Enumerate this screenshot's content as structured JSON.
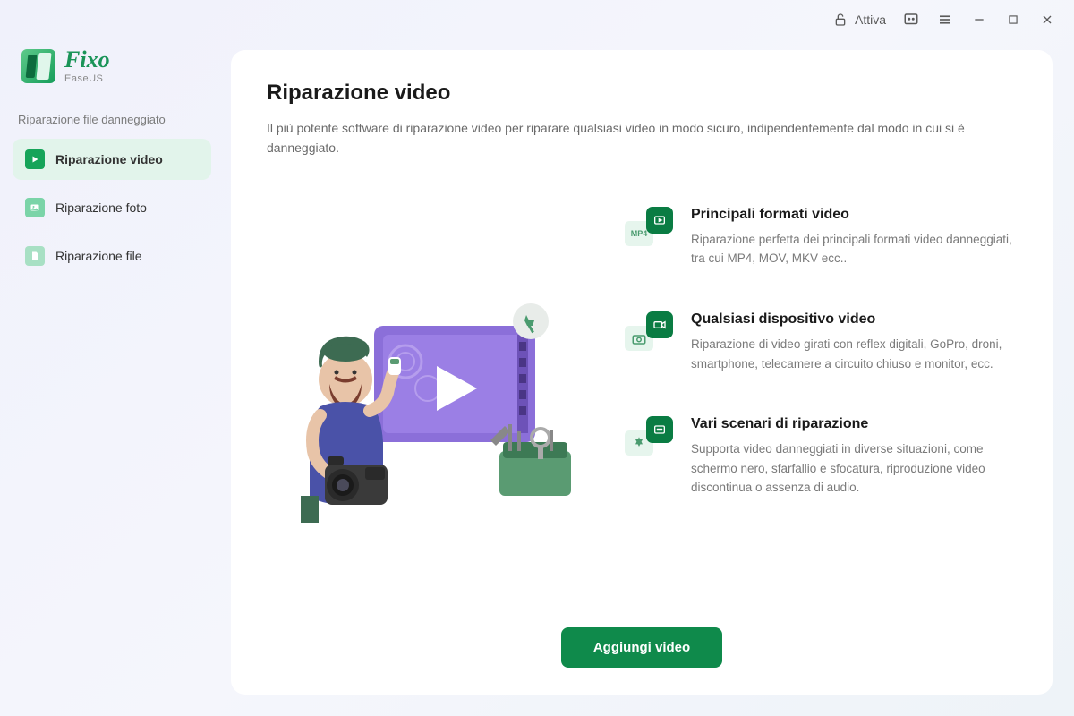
{
  "titlebar": {
    "activate_label": "Attiva"
  },
  "logo": {
    "name": "Fixo",
    "subtitle": "EaseUS"
  },
  "sidebar": {
    "section_label": "Riparazione file danneggiato",
    "items": [
      {
        "label": "Riparazione video"
      },
      {
        "label": "Riparazione foto"
      },
      {
        "label": "Riparazione file"
      }
    ]
  },
  "main": {
    "title": "Riparazione video",
    "description": "Il più potente software di riparazione video per riparare qualsiasi video in modo sicuro, indipendentemente dal modo in cui si è danneggiato.",
    "features": [
      {
        "badge": "MP4",
        "title": "Principali formati video",
        "desc": "Riparazione perfetta dei principali formati video danneggiati, tra cui MP4, MOV, MKV ecc.."
      },
      {
        "badge": "",
        "title": "Qualsiasi dispositivo video",
        "desc": "Riparazione di video girati con reflex digitali, GoPro, droni, smartphone, telecamere a circuito chiuso e monitor, ecc."
      },
      {
        "badge": "",
        "title": "Vari scenari di riparazione",
        "desc": "Supporta video danneggiati in diverse situazioni, come schermo nero, sfarfallio e sfocatura, riproduzione video discontinua o assenza di audio."
      }
    ],
    "cta_label": "Aggiungi video"
  }
}
